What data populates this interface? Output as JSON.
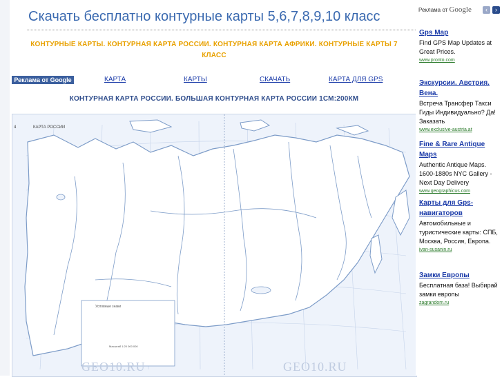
{
  "header": {
    "title": "Скачать бесплатно контурные карты 5,6,7,8,9,10 класс"
  },
  "subheading": "КОНТУРНЫЕ КАРТЫ. КОНТУРНАЯ КАРТА РОССИИ. КОНТУРНАЯ КАРТА АФРИКИ. КОНТУРНЫЕ КАРТЫ 7 КЛАСС",
  "nav": {
    "ads_badge": "Реклама от Google",
    "links": [
      "КАРТА",
      "КАРТЫ",
      "СКАЧАТЬ",
      "КАРТА ДЛЯ GPS"
    ]
  },
  "map": {
    "title": "КОНТУРНАЯ КАРТА РОССИИ. БОЛЬШАЯ КОНТУРНАЯ КАРТА РОССИИ 1СМ:200КМ",
    "inner_label": "КАРТА РОССИИ",
    "page_number": "4",
    "legend_label": "Условные знаки",
    "scale_text": "Масштаб 1:20 000 000",
    "watermark": "GEO10.RU"
  },
  "ads": {
    "by_label": "Реклама от",
    "by_brand": "Google",
    "nav_colors": {
      "prev": "#9aa8c8",
      "next": "#2a4c8c"
    },
    "items": [
      {
        "title": "Gps Map",
        "text": "Find GPS Map Updates at Great Prices.",
        "url": "www.pronto.com"
      },
      {
        "title": "Экскурсии. Австрия. Вена.",
        "text": "Встреча Трансфер Такси Гиды Индивидуально? Да! Заказать",
        "url": "www.exclusive-austria.at"
      },
      {
        "title": "Fine & Rare Antique Maps",
        "text": "Authentic Antique Maps. 1600-1880s NYC Gallery - Next Day Delivery",
        "url": "www.geographicus.com"
      },
      {
        "title": "Карты для Gps-навигаторов",
        "text": "Автомобильные и туристические карты: СПБ, Москва, Россия, Европа.",
        "url": "ivan-susanin.ru"
      },
      {
        "title": "Замки Европы",
        "text": "Бесплатная база! Выбирай замки европы",
        "url": "zagrandom.ru"
      }
    ]
  },
  "colors": {
    "title": "#3b6ab0",
    "subheading": "#e8a100",
    "link": "#1a3aa8",
    "map_water": "#eef3fb",
    "map_land": "#ffffff",
    "map_lines": "#7d9cc8"
  }
}
